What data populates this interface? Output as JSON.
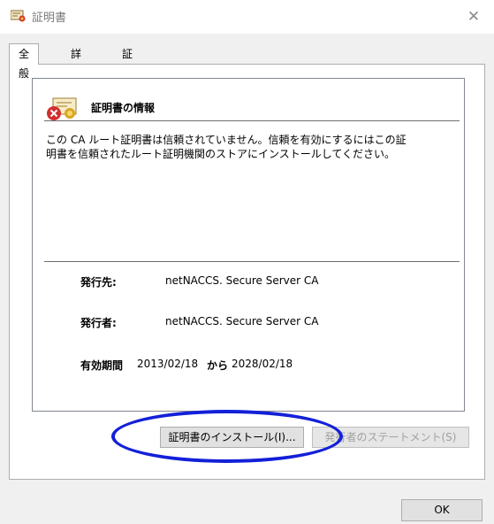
{
  "window": {
    "title": "証明書",
    "close_glyph": "✕"
  },
  "tabs": [
    {
      "label": "全般",
      "active": true
    },
    {
      "label": "詳細",
      "active": false
    },
    {
      "label": "証明のパス",
      "active": false
    }
  ],
  "info": {
    "title": "証明書の情報",
    "message_line1": "この CA ルート証明書は信頼されていません。信頼を有効にするにはこの証",
    "message_line2": "明書を信頼されたルート証明機関のストアにインストールしてください。"
  },
  "details": {
    "issued_to_label": "発行先:",
    "issued_to_value": "netNACCS. Secure Server CA",
    "issued_by_label": "発行者:",
    "issued_by_value": "netNACCS. Secure Server CA",
    "validity_label": "有効期間",
    "valid_from": "2013/02/18",
    "from_to_word": "から",
    "valid_to": "2028/02/18"
  },
  "buttons": {
    "install": "証明書のインストール(I)...",
    "issuer_statement": "発行者のステートメント(S)",
    "ok": "OK"
  },
  "colors": {
    "highlight_ring": "#1320d8"
  }
}
